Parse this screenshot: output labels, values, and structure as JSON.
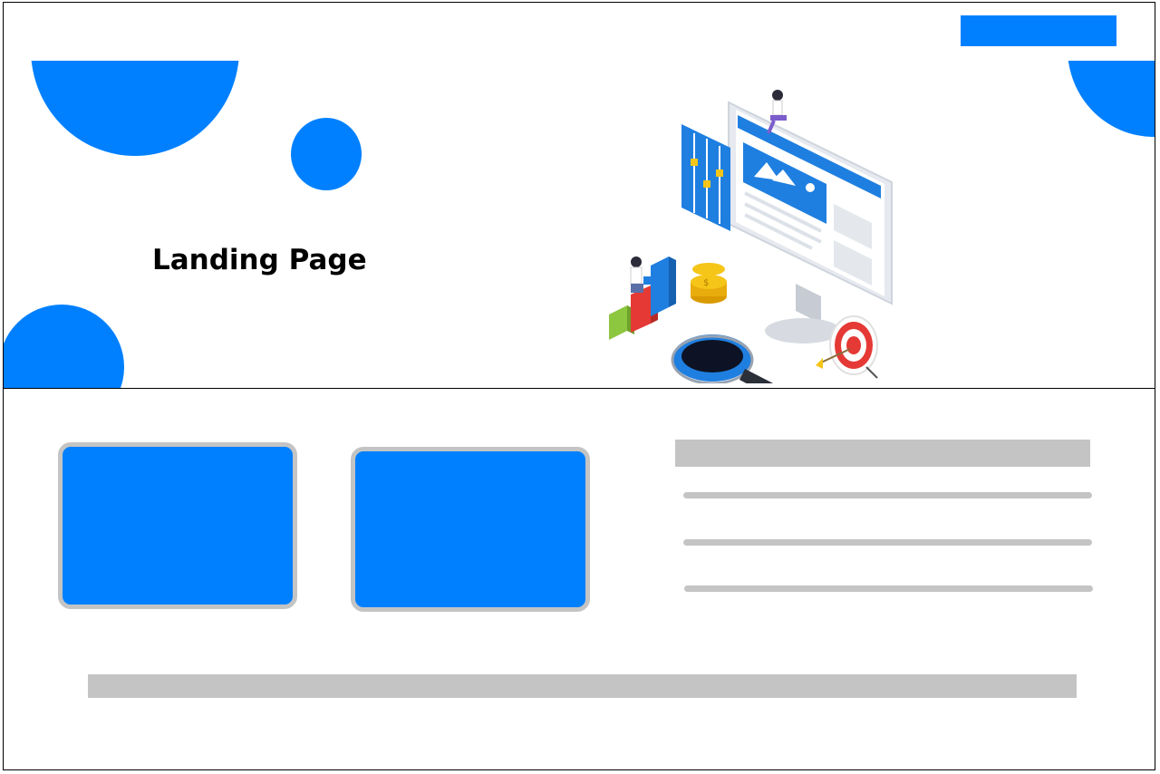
{
  "hero": {
    "title": "Landing Page"
  },
  "colors": {
    "accent": "#0080ff",
    "placeholder_gray": "#c4c4c4",
    "border": "#000000"
  },
  "header": {
    "button_icon": "blank-button"
  },
  "illustration": {
    "icon": "analytics-dashboard-illustration"
  }
}
